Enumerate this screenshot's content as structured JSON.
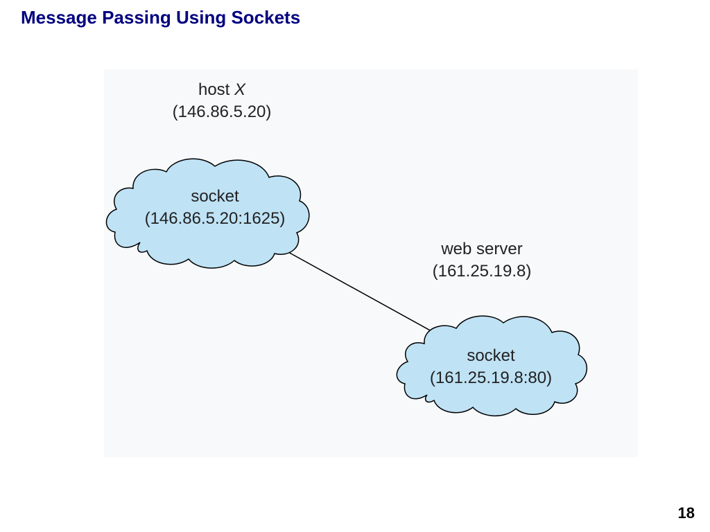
{
  "title": "Message Passing Using Sockets",
  "page_number": "18",
  "nodes": {
    "left": {
      "title_prefix": "host ",
      "title_em": "X",
      "ip": "(146.86.5.20)",
      "socket_label": "socket",
      "socket_addr": "(146.86.5.20:1625)"
    },
    "right": {
      "title": "web server",
      "ip": "(161.25.19.8)",
      "socket_label": "socket",
      "socket_addr": "(161.25.19.8:80)"
    }
  }
}
